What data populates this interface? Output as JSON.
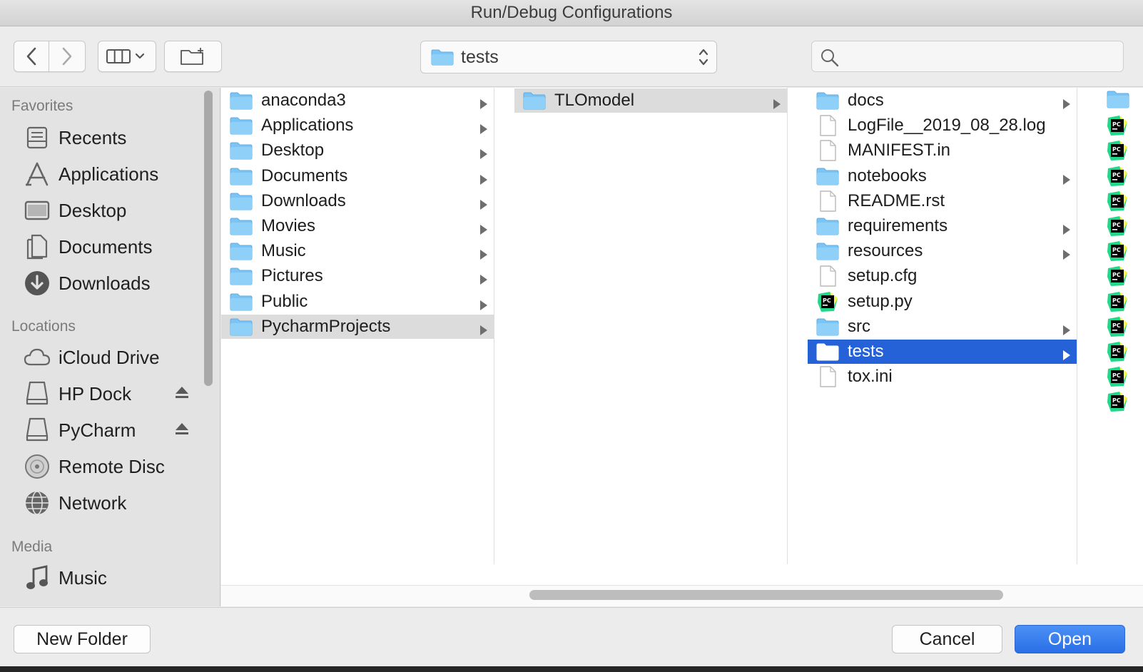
{
  "window": {
    "title": "Run/Debug Configurations"
  },
  "toolbar": {
    "path_popup_value": "tests",
    "search": {
      "value": "",
      "placeholder": ""
    }
  },
  "sidebar": {
    "favorites_header": "Favorites",
    "favorites": [
      {
        "label": "Recents",
        "icon": "recents-icon"
      },
      {
        "label": "Applications",
        "icon": "applications-icon"
      },
      {
        "label": "Desktop",
        "icon": "desktop-icon"
      },
      {
        "label": "Documents",
        "icon": "documents-icon"
      },
      {
        "label": "Downloads",
        "icon": "downloads-icon"
      }
    ],
    "locations_header": "Locations",
    "locations": [
      {
        "label": "iCloud Drive",
        "icon": "cloud-icon"
      },
      {
        "label": "HP Dock",
        "icon": "drive-icon",
        "ejectable": true
      },
      {
        "label": "PyCharm",
        "icon": "drive-icon",
        "ejectable": true
      },
      {
        "label": "Remote Disc",
        "icon": "disc-icon"
      },
      {
        "label": "Network",
        "icon": "network-icon"
      }
    ],
    "media_header": "Media",
    "media": [
      {
        "label": "Music",
        "icon": "music-note-icon"
      }
    ]
  },
  "columns": {
    "col1": [
      {
        "name": "anaconda3",
        "type": "folder"
      },
      {
        "name": "Applications",
        "type": "folder"
      },
      {
        "name": "Desktop",
        "type": "folder"
      },
      {
        "name": "Documents",
        "type": "folder"
      },
      {
        "name": "Downloads",
        "type": "folder"
      },
      {
        "name": "Movies",
        "type": "folder"
      },
      {
        "name": "Music",
        "type": "folder"
      },
      {
        "name": "Pictures",
        "type": "folder"
      },
      {
        "name": "Public",
        "type": "folder"
      },
      {
        "name": "PycharmProjects",
        "type": "folder",
        "selected": "inactive"
      }
    ],
    "col2": [
      {
        "name": "TLOmodel",
        "type": "folder",
        "selected": "inactive"
      }
    ],
    "col3": [
      {
        "name": "docs",
        "type": "folder"
      },
      {
        "name": "LogFile__2019_08_28.log",
        "type": "file"
      },
      {
        "name": "MANIFEST.in",
        "type": "file"
      },
      {
        "name": "notebooks",
        "type": "folder"
      },
      {
        "name": "README.rst",
        "type": "file"
      },
      {
        "name": "requirements",
        "type": "folder"
      },
      {
        "name": "resources",
        "type": "folder"
      },
      {
        "name": "setup.cfg",
        "type": "file"
      },
      {
        "name": "setup.py",
        "type": "pycharm-file"
      },
      {
        "name": "src",
        "type": "folder"
      },
      {
        "name": "tests",
        "type": "folder",
        "selected": "active"
      },
      {
        "name": "tox.ini",
        "type": "file"
      }
    ],
    "col4_icon_count": 13
  },
  "buttons": {
    "new_folder": "New Folder",
    "cancel": "Cancel",
    "open": "Open"
  },
  "colors": {
    "selection_blue": "#2562d8",
    "folder_blue": "#7cc4f3",
    "open_button": "#2a6fe6"
  }
}
